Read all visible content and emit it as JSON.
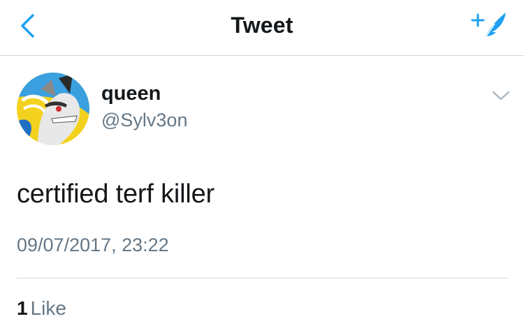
{
  "nav": {
    "title": "Tweet",
    "back_icon": "chevron-left-icon",
    "compose_icon": "compose-feather-icon"
  },
  "tweet": {
    "author": {
      "display_name": "queen",
      "handle": "@Sylv3on"
    },
    "text": "certified terf killer",
    "timestamp": "09/07/2017, 23:22",
    "likes": {
      "count": "1",
      "label": "Like"
    }
  },
  "colors": {
    "accent": "#1da1f2",
    "text_primary": "#14171a",
    "text_secondary": "#657786",
    "divider": "#cfd6dc"
  }
}
